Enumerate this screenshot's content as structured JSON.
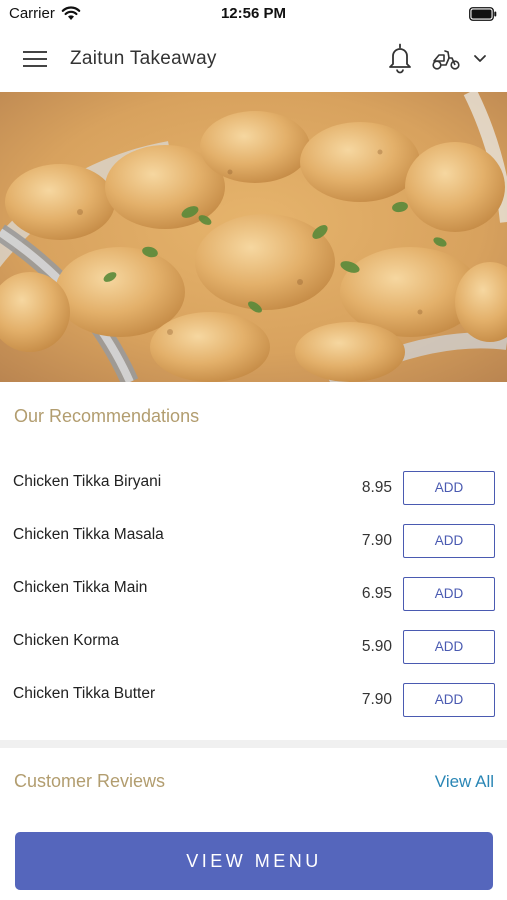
{
  "status_bar": {
    "carrier": "Carrier",
    "time": "12:56 PM"
  },
  "header": {
    "title": "Zaitun Takeaway"
  },
  "recommendations": {
    "title": "Our Recommendations",
    "items": [
      {
        "name": "Chicken Tikka Biryani",
        "price": "8.95",
        "button": "ADD"
      },
      {
        "name": "Chicken Tikka Masala",
        "price": "7.90",
        "button": "ADD"
      },
      {
        "name": "Chicken Tikka Main",
        "price": "6.95",
        "button": "ADD"
      },
      {
        "name": "Chicken Korma",
        "price": "5.90",
        "button": "ADD"
      },
      {
        "name": "Chicken Tikka Butter",
        "price": "7.90",
        "button": "ADD"
      }
    ]
  },
  "reviews": {
    "title": "Customer Reviews",
    "view_all": "View All"
  },
  "footer": {
    "view_menu": "VIEW MENU"
  },
  "colors": {
    "accent": "#5566bc",
    "section_title": "#b29d6f",
    "link": "#2a86b5"
  }
}
